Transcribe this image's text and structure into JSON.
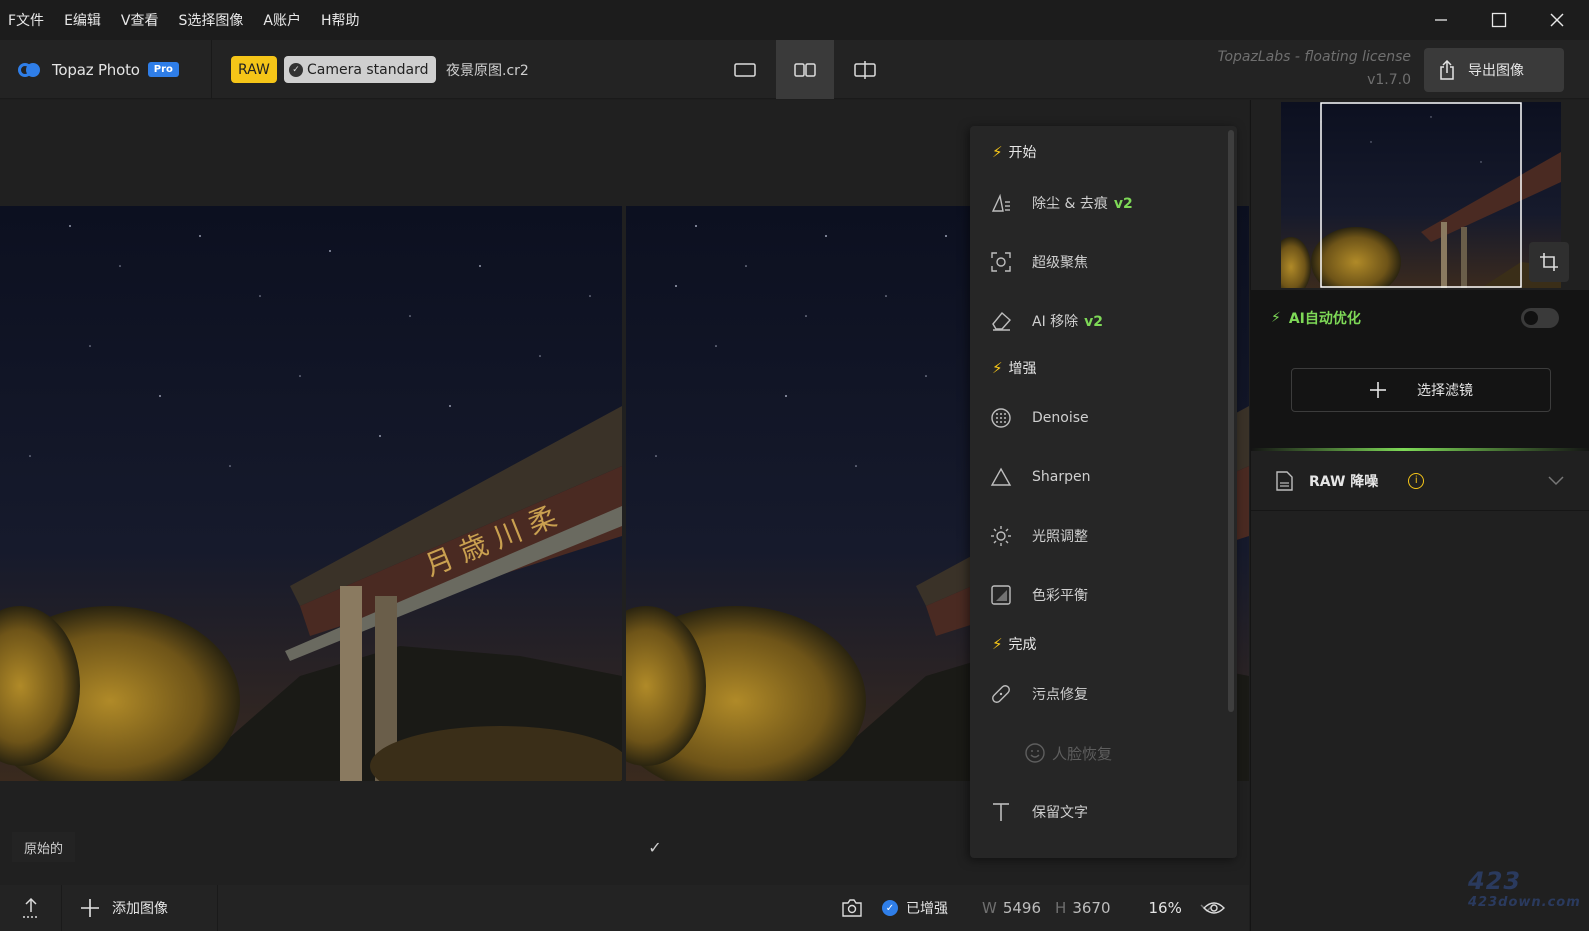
{
  "menubar": {
    "items": [
      "F文件",
      "E编辑",
      "V查看",
      "S选择图像",
      "A账户",
      "H帮助"
    ]
  },
  "toolbar": {
    "app_name": "Topaz Photo",
    "pro_label": "Pro",
    "raw_label": "RAW",
    "camera_profile": "Camera standard",
    "filename": "夜景原图.cr2",
    "license_line1": "TopazLabs - floating license",
    "license_line2": "v1.7.0",
    "export_label": "导出图像"
  },
  "canvas": {
    "original_label": "原始的",
    "processed_label": "✓"
  },
  "filter_menu": {
    "sections": [
      {
        "label": "开始",
        "items": [
          {
            "label": "除尘 & 去痕",
            "tag": "v2",
            "icon": "dust-icon"
          },
          {
            "label": "超级聚焦",
            "icon": "focus-icon"
          },
          {
            "label": "AI 移除",
            "tag": "v2",
            "icon": "eraser-icon"
          }
        ]
      },
      {
        "label": "增强",
        "items": [
          {
            "label": "Denoise",
            "icon": "denoise-icon"
          },
          {
            "label": "Sharpen",
            "icon": "sharpen-icon"
          },
          {
            "label": "光照调整",
            "icon": "light-icon"
          },
          {
            "label": "色彩平衡",
            "icon": "color-balance-icon"
          }
        ]
      },
      {
        "label": "完成",
        "items": [
          {
            "label": "污点修复",
            "icon": "bandage-icon"
          },
          {
            "label": "人脸恢复",
            "icon": "face-icon",
            "disabled": true
          },
          {
            "label": "保留文字",
            "icon": "text-icon"
          }
        ]
      }
    ]
  },
  "right_panel": {
    "ai_label": "AI自动优化",
    "ai_enabled": false,
    "add_filter_label": "选择滤镜",
    "raw_row_label": "RAW 降噪",
    "raw_info": "i"
  },
  "bottombar": {
    "add_image_label": "添加图像",
    "enhanced_label": "已增强",
    "width_key": "W",
    "width_value": "5496",
    "height_key": "H",
    "height_value": "3670",
    "zoom": "16%"
  },
  "watermark": {
    "big": "423",
    "small": "423down.com"
  },
  "colors": {
    "accent_blue": "#2f7ee8",
    "accent_green": "#7ed957",
    "raw_yellow": "#f5c518",
    "background": "#1e1e1e"
  }
}
